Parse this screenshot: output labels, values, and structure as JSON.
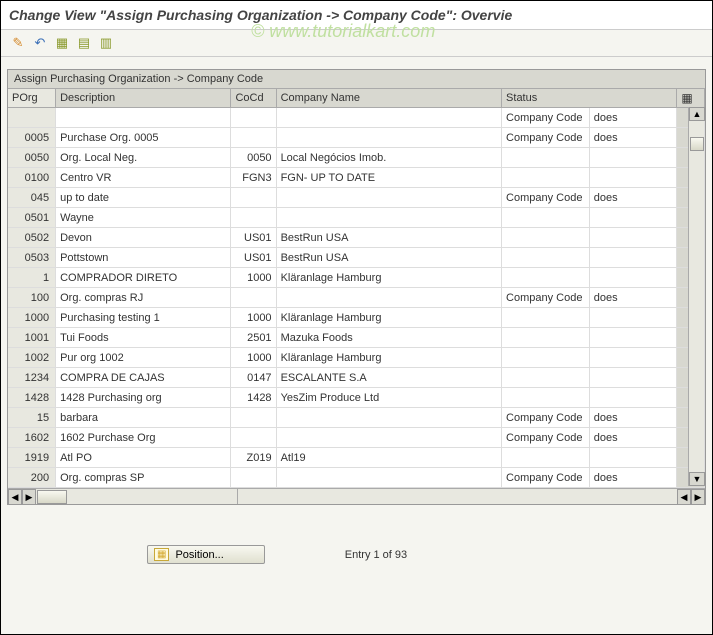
{
  "header": {
    "title": "Change View \"Assign Purchasing  Organization -> Company Code\": Overvie"
  },
  "watermark": "© www.tutorialkart.com",
  "toolbar": {
    "icons": [
      {
        "name": "change-icon",
        "glyph": "✎",
        "color": "#d48a2c"
      },
      {
        "name": "other-icon",
        "glyph": "⟲",
        "color": "#3a6fb7"
      },
      {
        "name": "select-all-icon",
        "glyph": "▭",
        "color": "#c8a838"
      },
      {
        "name": "select-block-icon",
        "glyph": "▭",
        "color": "#c8a838"
      },
      {
        "name": "deselect-icon",
        "glyph": "▭",
        "color": "#c8a838"
      }
    ]
  },
  "table": {
    "title": "Assign Purchasing  Organization -> Company Code",
    "columns": {
      "porg": "POrg",
      "description": "Description",
      "cocd": "CoCd",
      "company_name": "Company Name",
      "status": "Status"
    },
    "rows": [
      {
        "porg": "",
        "description": "",
        "cocd": "",
        "company_name": "",
        "status1": "Company Code",
        "status2": "does"
      },
      {
        "porg": "0005",
        "description": "Purchase Org. 0005",
        "cocd": "",
        "company_name": "",
        "status1": "Company Code",
        "status2": "does"
      },
      {
        "porg": "0050",
        "description": "Org. Local Neg.",
        "cocd": "0050",
        "company_name": "Local Negócios Imob.",
        "status1": "",
        "status2": ""
      },
      {
        "porg": "0100",
        "description": "Centro VR",
        "cocd": "FGN3",
        "company_name": "FGN- UP TO DATE",
        "status1": "",
        "status2": ""
      },
      {
        "porg": "045",
        "description": "up to date",
        "cocd": "",
        "company_name": "",
        "status1": "Company Code",
        "status2": "does"
      },
      {
        "porg": "0501",
        "description": "Wayne",
        "cocd": "",
        "company_name": "",
        "status1": "",
        "status2": ""
      },
      {
        "porg": "0502",
        "description": "Devon",
        "cocd": "US01",
        "company_name": "BestRun USA",
        "status1": "",
        "status2": ""
      },
      {
        "porg": "0503",
        "description": "Pottstown",
        "cocd": "US01",
        "company_name": "BestRun USA",
        "status1": "",
        "status2": ""
      },
      {
        "porg": "1",
        "description": "COMPRADOR DIRETO",
        "cocd": "1000",
        "company_name": "Kläranlage Hamburg",
        "status1": "",
        "status2": ""
      },
      {
        "porg": "100",
        "description": "Org. compras RJ",
        "cocd": "",
        "company_name": "",
        "status1": "Company Code",
        "status2": "does"
      },
      {
        "porg": "1000",
        "description": "Purchasing testing 1",
        "cocd": "1000",
        "company_name": "Kläranlage Hamburg",
        "status1": "",
        "status2": ""
      },
      {
        "porg": "1001",
        "description": "Tui Foods",
        "cocd": "2501",
        "company_name": "Mazuka Foods",
        "status1": "",
        "status2": ""
      },
      {
        "porg": "1002",
        "description": "Pur org 1002",
        "cocd": "1000",
        "company_name": "Kläranlage Hamburg",
        "status1": "",
        "status2": ""
      },
      {
        "porg": "1234",
        "description": "COMPRA DE CAJAS",
        "cocd": "0147",
        "company_name": "ESCALANTE S.A",
        "status1": "",
        "status2": ""
      },
      {
        "porg": "1428",
        "description": "1428 Purchasing org",
        "cocd": "1428",
        "company_name": "YesZim Produce Ltd",
        "status1": "",
        "status2": ""
      },
      {
        "porg": "15",
        "description": "barbara",
        "cocd": "",
        "company_name": "",
        "status1": "Company Code",
        "status2": "does"
      },
      {
        "porg": "1602",
        "description": "1602 Purchase Org",
        "cocd": "",
        "company_name": "",
        "status1": "Company Code",
        "status2": "does"
      },
      {
        "porg": "1919",
        "description": "Atl PO",
        "cocd": "Z019",
        "company_name": "Atl19",
        "status1": "",
        "status2": ""
      },
      {
        "porg": "200",
        "description": "Org. compras SP",
        "cocd": "",
        "company_name": "",
        "status1": "Company Code",
        "status2": "does"
      }
    ]
  },
  "footer": {
    "position_button": "Position...",
    "entry_text": "Entry 1 of 93"
  }
}
